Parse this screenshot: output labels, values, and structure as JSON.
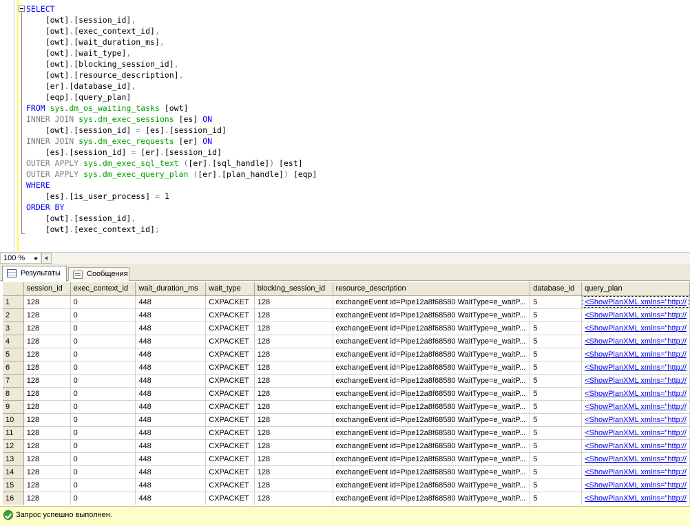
{
  "editor": {
    "lines": [
      [
        [
          "kw",
          "SELECT"
        ]
      ],
      [
        [
          "tx",
          "    [owt]"
        ],
        [
          "gr",
          "."
        ],
        [
          "tx",
          "[session_id]"
        ],
        [
          "gr",
          ","
        ]
      ],
      [
        [
          "tx",
          "    [owt]"
        ],
        [
          "gr",
          "."
        ],
        [
          "tx",
          "[exec_context_id]"
        ],
        [
          "gr",
          ","
        ]
      ],
      [
        [
          "tx",
          "    [owt]"
        ],
        [
          "gr",
          "."
        ],
        [
          "tx",
          "[wait_duration_ms]"
        ],
        [
          "gr",
          ","
        ]
      ],
      [
        [
          "tx",
          "    [owt]"
        ],
        [
          "gr",
          "."
        ],
        [
          "tx",
          "[wait_type]"
        ],
        [
          "gr",
          ","
        ]
      ],
      [
        [
          "tx",
          "    [owt]"
        ],
        [
          "gr",
          "."
        ],
        [
          "tx",
          "[blocking_session_id]"
        ],
        [
          "gr",
          ","
        ]
      ],
      [
        [
          "tx",
          "    [owt]"
        ],
        [
          "gr",
          "."
        ],
        [
          "tx",
          "[resource_description]"
        ],
        [
          "gr",
          ","
        ]
      ],
      [
        [
          "tx",
          "    [er]"
        ],
        [
          "gr",
          "."
        ],
        [
          "tx",
          "[database_id]"
        ],
        [
          "gr",
          ","
        ]
      ],
      [
        [
          "tx",
          "    [eqp]"
        ],
        [
          "gr",
          "."
        ],
        [
          "tx",
          "[query_plan]"
        ]
      ],
      [
        [
          "kw",
          "FROM "
        ],
        [
          "fn",
          "sys.dm_os_waiting_tasks"
        ],
        [
          "tx",
          " [owt]"
        ]
      ],
      [
        [
          "gr",
          "INNER JOIN "
        ],
        [
          "fn",
          "sys.dm_exec_sessions"
        ],
        [
          "tx",
          " [es] "
        ],
        [
          "kw",
          "ON"
        ]
      ],
      [
        [
          "tx",
          "    [owt]"
        ],
        [
          "gr",
          "."
        ],
        [
          "tx",
          "[session_id] "
        ],
        [
          "gr",
          "="
        ],
        [
          "tx",
          " [es]"
        ],
        [
          "gr",
          "."
        ],
        [
          "tx",
          "[session_id]"
        ]
      ],
      [
        [
          "gr",
          "INNER JOIN "
        ],
        [
          "fn",
          "sys.dm_exec_requests"
        ],
        [
          "tx",
          " [er] "
        ],
        [
          "kw",
          "ON"
        ]
      ],
      [
        [
          "tx",
          "    [es]"
        ],
        [
          "gr",
          "."
        ],
        [
          "tx",
          "[session_id] "
        ],
        [
          "gr",
          "="
        ],
        [
          "tx",
          " [er]"
        ],
        [
          "gr",
          "."
        ],
        [
          "tx",
          "[session_id]"
        ]
      ],
      [
        [
          "gr",
          "OUTER APPLY "
        ],
        [
          "fn",
          "sys.dm_exec_sql_text"
        ],
        [
          "tx",
          " "
        ],
        [
          "gr",
          "("
        ],
        [
          "tx",
          "[er]"
        ],
        [
          "gr",
          "."
        ],
        [
          "tx",
          "[sql_handle]"
        ],
        [
          "gr",
          ")"
        ],
        [
          "tx",
          " [est]"
        ]
      ],
      [
        [
          "gr",
          "OUTER APPLY "
        ],
        [
          "fn",
          "sys.dm_exec_query_plan"
        ],
        [
          "tx",
          " "
        ],
        [
          "gr",
          "("
        ],
        [
          "tx",
          "[er]"
        ],
        [
          "gr",
          "."
        ],
        [
          "tx",
          "[plan_handle]"
        ],
        [
          "gr",
          ")"
        ],
        [
          "tx",
          " [eqp]"
        ]
      ],
      [
        [
          "kw",
          "WHERE"
        ]
      ],
      [
        [
          "tx",
          "    [es]"
        ],
        [
          "gr",
          "."
        ],
        [
          "tx",
          "[is_user_process] "
        ],
        [
          "gr",
          "="
        ],
        [
          "tx",
          " 1"
        ]
      ],
      [
        [
          "kw",
          "ORDER BY"
        ]
      ],
      [
        [
          "tx",
          "    [owt]"
        ],
        [
          "gr",
          "."
        ],
        [
          "tx",
          "[session_id]"
        ],
        [
          "gr",
          ","
        ]
      ],
      [
        [
          "tx",
          "    [owt]"
        ],
        [
          "gr",
          "."
        ],
        [
          "tx",
          "[exec_context_id]"
        ],
        [
          "gr",
          ";"
        ]
      ]
    ]
  },
  "zoom": {
    "value": "100 %"
  },
  "tabs": {
    "results": "Результаты",
    "messages": "Сообщения"
  },
  "grid": {
    "columns": [
      "session_id",
      "exec_context_id",
      "wait_duration_ms",
      "wait_type",
      "blocking_session_id",
      "resource_description",
      "database_id",
      "query_plan"
    ],
    "rows": [
      [
        "1",
        "128",
        "0",
        "448",
        "CXPACKET",
        "128",
        "exchangeEvent id=Pipe12a8f68580 WaitType=e_waitP...",
        "5",
        "<ShowPlanXML xmlns=\"http://"
      ],
      [
        "2",
        "128",
        "0",
        "448",
        "CXPACKET",
        "128",
        "exchangeEvent id=Pipe12a8f68580 WaitType=e_waitP...",
        "5",
        "<ShowPlanXML xmlns=\"http://"
      ],
      [
        "3",
        "128",
        "0",
        "448",
        "CXPACKET",
        "128",
        "exchangeEvent id=Pipe12a8f68580 WaitType=e_waitP...",
        "5",
        "<ShowPlanXML xmlns=\"http://"
      ],
      [
        "4",
        "128",
        "0",
        "448",
        "CXPACKET",
        "128",
        "exchangeEvent id=Pipe12a8f68580 WaitType=e_waitP...",
        "5",
        "<ShowPlanXML xmlns=\"http://"
      ],
      [
        "5",
        "128",
        "0",
        "448",
        "CXPACKET",
        "128",
        "exchangeEvent id=Pipe12a8f68580 WaitType=e_waitP...",
        "5",
        "<ShowPlanXML xmlns=\"http://"
      ],
      [
        "6",
        "128",
        "0",
        "448",
        "CXPACKET",
        "128",
        "exchangeEvent id=Pipe12a8f68580 WaitType=e_waitP...",
        "5",
        "<ShowPlanXML xmlns=\"http://"
      ],
      [
        "7",
        "128",
        "0",
        "448",
        "CXPACKET",
        "128",
        "exchangeEvent id=Pipe12a8f68580 WaitType=e_waitP...",
        "5",
        "<ShowPlanXML xmlns=\"http://"
      ],
      [
        "8",
        "128",
        "0",
        "448",
        "CXPACKET",
        "128",
        "exchangeEvent id=Pipe12a8f68580 WaitType=e_waitP...",
        "5",
        "<ShowPlanXML xmlns=\"http://"
      ],
      [
        "9",
        "128",
        "0",
        "448",
        "CXPACKET",
        "128",
        "exchangeEvent id=Pipe12a8f68580 WaitType=e_waitP...",
        "5",
        "<ShowPlanXML xmlns=\"http://"
      ],
      [
        "10",
        "128",
        "0",
        "448",
        "CXPACKET",
        "128",
        "exchangeEvent id=Pipe12a8f68580 WaitType=e_waitP...",
        "5",
        "<ShowPlanXML xmlns=\"http://"
      ],
      [
        "11",
        "128",
        "0",
        "448",
        "CXPACKET",
        "128",
        "exchangeEvent id=Pipe12a8f68580 WaitType=e_waitP...",
        "5",
        "<ShowPlanXML xmlns=\"http://"
      ],
      [
        "12",
        "128",
        "0",
        "448",
        "CXPACKET",
        "128",
        "exchangeEvent id=Pipe12a8f68580 WaitType=e_waitP...",
        "5",
        "<ShowPlanXML xmlns=\"http://"
      ],
      [
        "13",
        "128",
        "0",
        "448",
        "CXPACKET",
        "128",
        "exchangeEvent id=Pipe12a8f68580 WaitType=e_waitP...",
        "5",
        "<ShowPlanXML xmlns=\"http://"
      ],
      [
        "14",
        "128",
        "0",
        "448",
        "CXPACKET",
        "128",
        "exchangeEvent id=Pipe12a8f68580 WaitType=e_waitP...",
        "5",
        "<ShowPlanXML xmlns=\"http://"
      ],
      [
        "15",
        "128",
        "0",
        "448",
        "CXPACKET",
        "128",
        "exchangeEvent id=Pipe12a8f68580 WaitType=e_waitP...",
        "5",
        "<ShowPlanXML xmlns=\"http://"
      ],
      [
        "16",
        "128",
        "0",
        "448",
        "CXPACKET",
        "128",
        "exchangeEvent id=Pipe12a8f68580 WaitType=e_waitP...",
        "5",
        "<ShowPlanXML xmlns=\"http://"
      ]
    ]
  },
  "status": {
    "text": "Запрос успешно выполнен.",
    "icon": "success-check-icon"
  },
  "colors": {
    "keyword": "#0000ff",
    "operator": "#808080",
    "function": "#00a000",
    "link": "#0000ee",
    "status_bg": "#fefec8"
  }
}
